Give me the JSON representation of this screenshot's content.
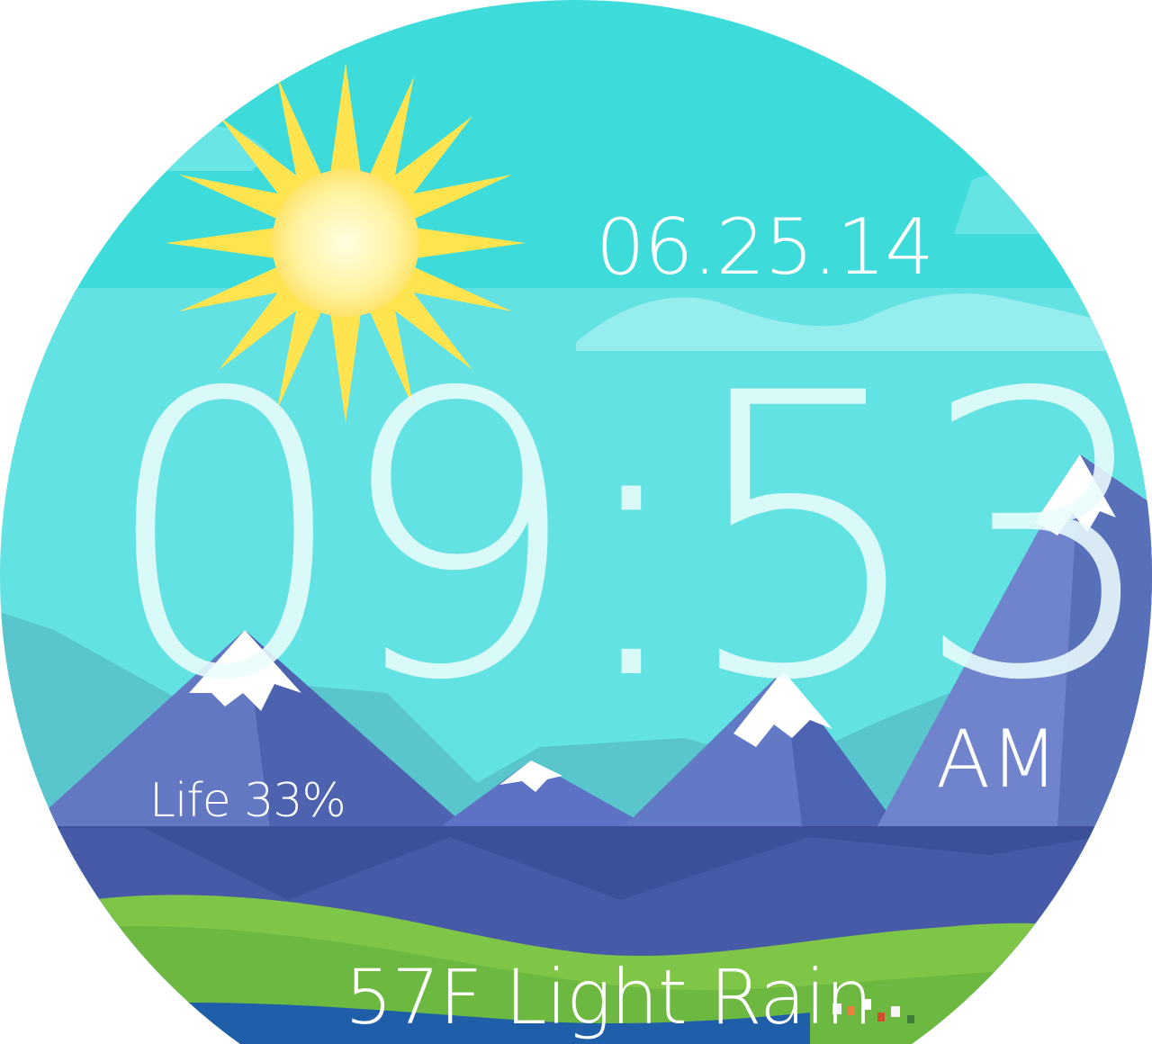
{
  "watch_face": {
    "date": "06.25.14",
    "time": "09:53",
    "ampm": "AM",
    "battery": "Life 33%",
    "weather": "57F Light Rain"
  },
  "icons": {
    "sun": "sun-icon"
  },
  "colors": {
    "sky_top": "#3edbdb",
    "sky_bottom": "#63e2e3",
    "sun_core": "#fff5a8",
    "sun_rays": "#ffe14a",
    "mountain_main": "#5b76c7",
    "mountain_shade": "#3f59ab",
    "foothills": "#3c4f9a",
    "grass_light": "#8ccf4b",
    "grass_dark": "#6eb83f",
    "river": "#1f5ea9",
    "snow": "#ffffff"
  }
}
